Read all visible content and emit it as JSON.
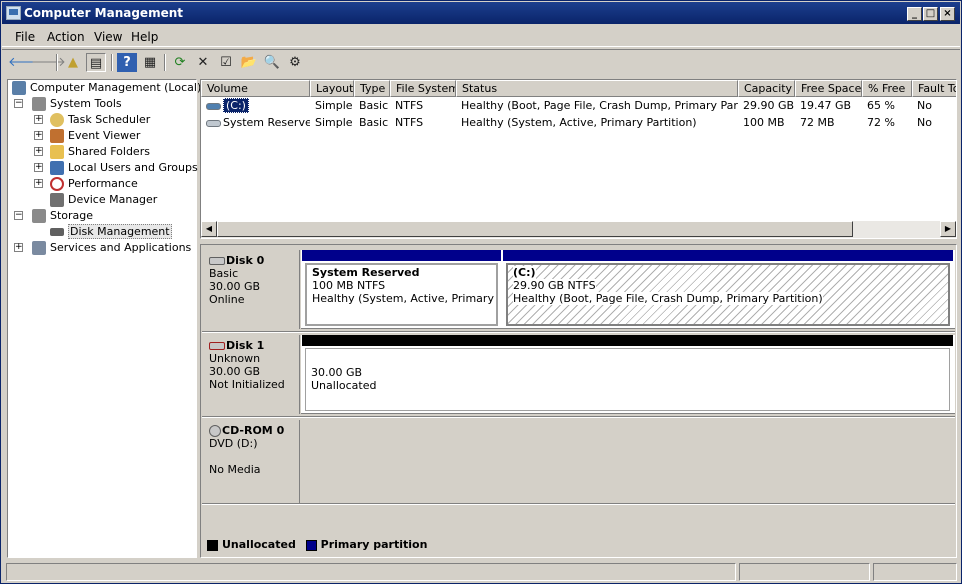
{
  "window": {
    "title": "Computer Management"
  },
  "menu": [
    "File",
    "Action",
    "View",
    "Help"
  ],
  "toolbar": [
    {
      "icon": "back-arrow-icon",
      "glyph": "🡐"
    },
    {
      "icon": "forward-arrow-icon",
      "glyph": "🡒"
    },
    {
      "icon": "up-folder-icon",
      "glyph": "▲"
    },
    {
      "icon": "show-hide-tree-icon",
      "glyph": "▤"
    },
    {
      "icon": "help-icon",
      "glyph": "?"
    },
    {
      "icon": "properties-pane-icon",
      "glyph": "▦"
    },
    {
      "icon": "refresh-icon",
      "glyph": "⟳"
    },
    {
      "icon": "delete-icon",
      "glyph": "✕"
    },
    {
      "icon": "properties-icon",
      "glyph": "☑"
    },
    {
      "icon": "open-icon",
      "glyph": "📂"
    },
    {
      "icon": "search-icon",
      "glyph": "🔍"
    },
    {
      "icon": "settings-icon",
      "glyph": "⚙"
    }
  ],
  "tree": [
    {
      "label": "Computer Management (Local)",
      "icon": "computer-icon",
      "color": "#5a7fa8"
    },
    {
      "label": "System Tools",
      "icon": "tools-icon",
      "color": "#8a8a8a",
      "expander": "−"
    },
    {
      "label": "Task Scheduler",
      "icon": "clock-icon",
      "color": "#e0c060",
      "expander": "+"
    },
    {
      "label": "Event Viewer",
      "icon": "event-viewer-icon",
      "color": "#c07030",
      "expander": "+"
    },
    {
      "label": "Shared Folders",
      "icon": "shared-folder-icon",
      "color": "#e8c050",
      "expander": "+"
    },
    {
      "label": "Local Users and Groups",
      "icon": "users-icon",
      "color": "#4070b0",
      "expander": "+"
    },
    {
      "label": "Performance",
      "icon": "performance-icon",
      "color": "#c03030",
      "expander": "+"
    },
    {
      "label": "Device Manager",
      "icon": "device-manager-icon",
      "color": "#707070"
    },
    {
      "label": "Storage",
      "icon": "storage-icon",
      "color": "#8a8a8a",
      "expander": "−"
    },
    {
      "label": "Disk Management",
      "icon": "disk-management-icon",
      "color": "#606060",
      "selected": true
    },
    {
      "label": "Services and Applications",
      "icon": "services-icon",
      "color": "#7a8aa0",
      "expander": "+"
    }
  ],
  "volumes": {
    "columns": [
      "Volume",
      "Layout",
      "Type",
      "File System",
      "Status",
      "Capacity",
      "Free Space",
      "% Free",
      "Fault To"
    ],
    "rows": [
      [
        "(C:)",
        "Simple",
        "Basic",
        "NTFS",
        "Healthy (Boot, Page File, Crash Dump, Primary Partition)",
        "29.90 GB",
        "19.47 GB",
        "65 %",
        "No"
      ],
      [
        "System Reserved",
        "Simple",
        "Basic",
        "NTFS",
        "Healthy (System, Active, Primary Partition)",
        "100 MB",
        "72 MB",
        "72 %",
        "No"
      ]
    ]
  },
  "disks": [
    {
      "name": "Disk 0",
      "lines": [
        "Basic",
        "30.00 GB",
        "Online"
      ],
      "partitions": [
        {
          "title": "System Reserved",
          "size": "100 MB NTFS",
          "status": "Healthy (System, Active, Primary Partition)",
          "bar_color": "#00008b"
        },
        {
          "title": "(C:)",
          "size": "29.90 GB NTFS",
          "status": "Healthy (Boot, Page File, Crash Dump, Primary Partition)",
          "bar_color": "#00008b"
        }
      ]
    },
    {
      "name": "Disk 1",
      "lines": [
        "Unknown",
        "30.00 GB",
        "Not Initialized"
      ],
      "partitions": [
        {
          "title": "",
          "size": "30.00 GB",
          "status": "Unallocated",
          "bar_color": "#000000"
        }
      ]
    },
    {
      "name": "CD-ROM 0",
      "lines": [
        "DVD (D:)",
        "",
        "No Media"
      ],
      "partitions": []
    }
  ],
  "legend": [
    {
      "label": "Unallocated",
      "color": "#000000"
    },
    {
      "label": "Primary partition",
      "color": "#00008b"
    }
  ]
}
